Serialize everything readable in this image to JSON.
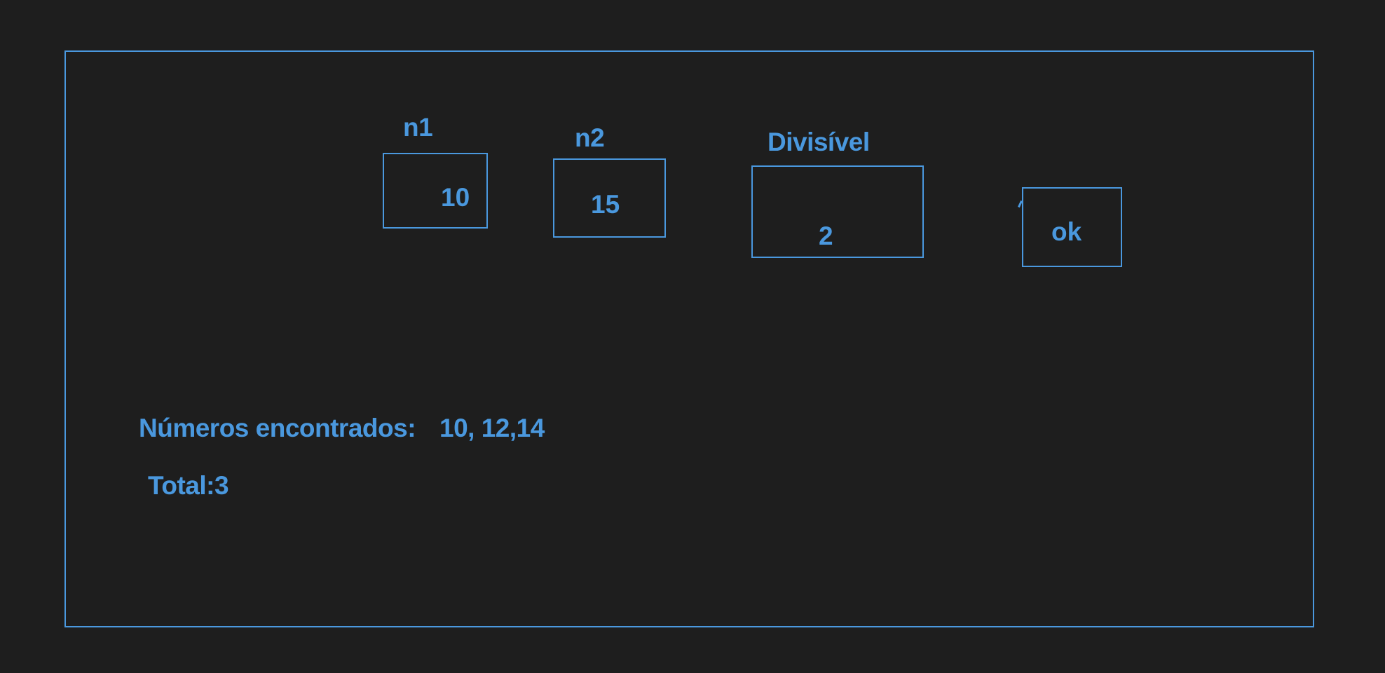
{
  "form": {
    "n1": {
      "label": "n1",
      "value": "10"
    },
    "n2": {
      "label": "n2",
      "value": "15"
    },
    "divisivel": {
      "label": "Divisível",
      "value": "2"
    },
    "ok_button": {
      "label": "ok"
    }
  },
  "results": {
    "found_label": "Números encontrados:",
    "found_values": "10, 12,14",
    "total_label": "Total:3"
  },
  "colors": {
    "background": "#1e1e1e",
    "accent": "#4a98de"
  }
}
